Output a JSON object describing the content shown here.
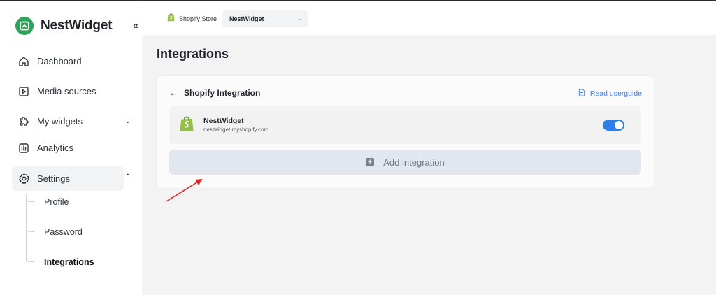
{
  "brand": {
    "name": "NestWidget",
    "logo_color": "#2ea35b"
  },
  "sidebar": {
    "collapse_label": "«",
    "items": [
      {
        "label": "Dashboard",
        "icon": "home-icon"
      },
      {
        "label": "Media sources",
        "icon": "play-square-icon"
      },
      {
        "label": "My widgets",
        "icon": "puzzle-icon",
        "expandable": true
      },
      {
        "label": "Analytics",
        "icon": "bar-chart-icon"
      },
      {
        "label": "Settings",
        "icon": "gear-icon",
        "expanded": true,
        "active": true
      }
    ],
    "settings_children": [
      {
        "label": "Profile"
      },
      {
        "label": "Password"
      },
      {
        "label": "Integrations",
        "active": true
      }
    ]
  },
  "header": {
    "store_label": "Shopify Store",
    "store_select_value": "NestWidget"
  },
  "main": {
    "title": "Integrations",
    "card": {
      "title": "Shopify Integration",
      "guide_link": "Read userguide",
      "integration": {
        "name": "NestWidget",
        "domain": "nestwidget.myshopify.com",
        "enabled": true
      },
      "add_button": "Add integration"
    }
  },
  "colors": {
    "accent": "#2f7fe6",
    "link": "#3d7de8",
    "shopify_green": "#95bf47",
    "annotation_arrow": "#e02424"
  }
}
